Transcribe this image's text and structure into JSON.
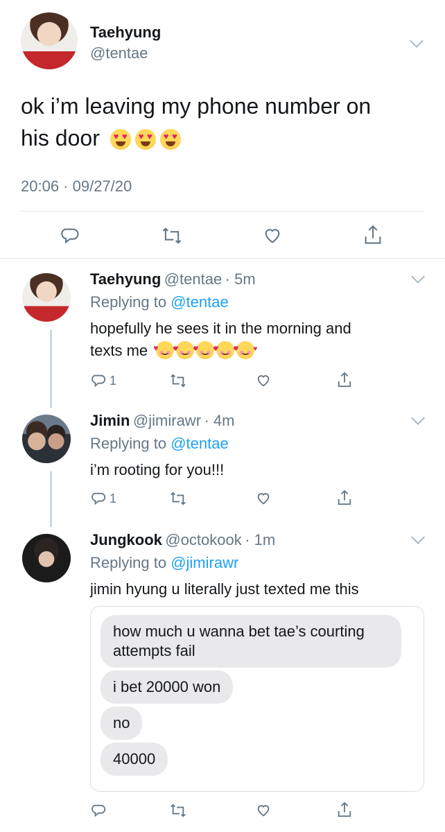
{
  "main_tweet": {
    "name": "Taehyung",
    "handle": "@tentae",
    "text_line1": "ok i’m leaving my phone number on",
    "text_line2": "his door",
    "timestamp": "20:06 · 09/27/20",
    "emoji": "smiling-face-with-heart-eyes"
  },
  "replies": [
    {
      "name": "Taehyung",
      "handle": "@tentae",
      "time": "· 5m",
      "replying_prefix": "Replying to ",
      "replying_to": "@tentae",
      "text_line1": "hopefully he sees it in the morning and",
      "text_line2": "texts me",
      "emoji": "smiling-face-with-hearts",
      "reply_count": "1"
    },
    {
      "name": "Jimin",
      "handle": "@jimirawr",
      "time": "· 4m",
      "replying_prefix": "Replying to ",
      "replying_to": "@tentae",
      "text": "i’m rooting for you!!!",
      "reply_count": "1"
    },
    {
      "name": "Jungkook",
      "handle": "@octokook",
      "time": "· 1m",
      "replying_prefix": "Replying to ",
      "replying_to": "@jimirawr",
      "text": "jimin hyung u literally just texted me this",
      "messages": [
        {
          "line1": "how much u wanna bet tae’s courting",
          "line2": "attempts fail"
        },
        {
          "line1": "i bet 20000 won"
        },
        {
          "line1": "no"
        },
        {
          "line1": "40000"
        }
      ]
    }
  ],
  "colors": {
    "link": "#1da1f2",
    "secondary_text": "#657786",
    "bubble_grey": "#e9e9eb",
    "divider": "#e1e8ed"
  },
  "icons": [
    "reply-icon",
    "retweet-icon",
    "like-icon",
    "share-icon",
    "chevron-down-icon"
  ]
}
